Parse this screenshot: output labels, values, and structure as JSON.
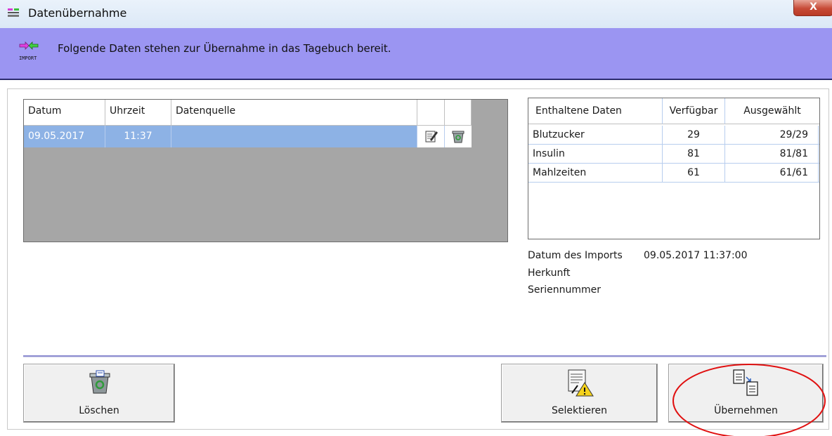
{
  "window": {
    "title": "Datenübernahme",
    "close_label": "X"
  },
  "banner": {
    "icon_caption": "IMPORT",
    "message": "Folgende Daten stehen zur Übernahme in das Tagebuch bereit."
  },
  "imports_table": {
    "columns": [
      "Datum",
      "Uhrzeit",
      "Datenquelle",
      "",
      ""
    ],
    "rows": [
      {
        "datum": "09.05.2017",
        "uhrzeit": "11:37",
        "datenquelle": "",
        "selected": true
      }
    ]
  },
  "data_table": {
    "columns": [
      "Enthaltene Daten",
      "Verfügbar",
      "Ausgewählt"
    ],
    "rows": [
      {
        "name": "Blutzucker",
        "verfuegbar": "29",
        "ausgewaehlt": "29/29"
      },
      {
        "name": "Insulin",
        "verfuegbar": "81",
        "ausgewaehlt": "81/81"
      },
      {
        "name": "Mahlzeiten",
        "verfuegbar": "61",
        "ausgewaehlt": "61/61"
      }
    ]
  },
  "import_info": {
    "date_label": "Datum des Imports",
    "date_value": "09.05.2017 11:37:00",
    "origin_label": "Herkunft",
    "serial_label": "Seriennummer"
  },
  "buttons": {
    "delete": {
      "label": "Löschen",
      "icon": "recycle-bin-icon"
    },
    "select": {
      "label": "Selektieren",
      "icon": "document-warning-icon"
    },
    "apply": {
      "label": "Übernehmen",
      "icon": "document-transfer-icon"
    }
  },
  "colors": {
    "banner": "#9b95f2",
    "selected_row": "#8db2e5",
    "grid_background": "#a6a6a6",
    "highlight_ellipse": "#e01010"
  }
}
